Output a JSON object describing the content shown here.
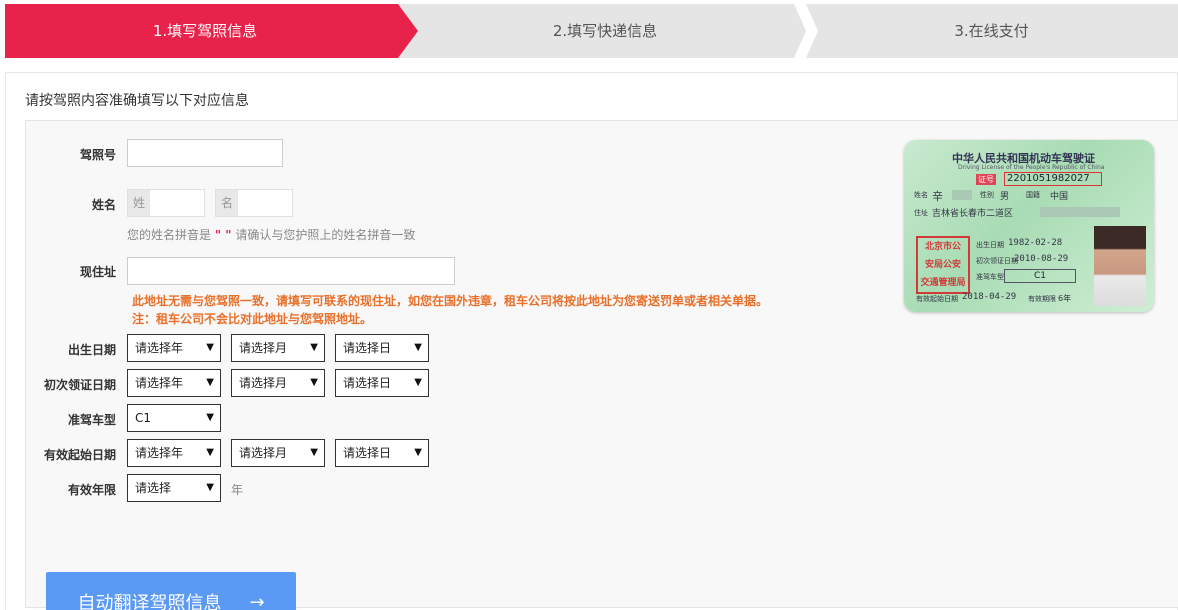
{
  "steps": [
    {
      "label": "1.填写驾照信息",
      "active": true
    },
    {
      "label": "2.填写快递信息",
      "active": false
    },
    {
      "label": "3.在线支付",
      "active": false
    }
  ],
  "colors": {
    "accent": "#e8234b",
    "inactive_step": "#e5e5e5",
    "button": "#5b9af4",
    "warning": "#e8702a"
  },
  "intro": "请按驾照内容准确填写以下对应信息",
  "form": {
    "license_no_label": "驾照号",
    "license_no_value": "",
    "name_label": "姓名",
    "surname_prefix": "姓",
    "given_prefix": "名",
    "name_hint_before": "您的姓名拼音是",
    "name_hint_quote": "\" \"",
    "name_hint_after": "请确认与您护照上的姓名拼音一致",
    "address_label": "现住址",
    "address_value": "",
    "address_warning_1": "此地址无需与您驾照一致，请填写可联系的现住址，如您在国外违章，租车公司将按此地址为您寄送罚单或者相关单据。",
    "address_warning_2": "注：租车公司不会比对此地址与您驾照地址。",
    "birth_label": "出生日期",
    "first_issue_label": "初次领证日期",
    "vehicle_class_label": "准驾车型",
    "valid_start_label": "有效起始日期",
    "valid_years_label": "有效年限",
    "year_placeholder": "请选择年",
    "month_placeholder": "请选择月",
    "day_placeholder": "请选择日",
    "vehicle_class_value": "C1",
    "valid_years_placeholder": "请选择",
    "valid_years_unit": "年"
  },
  "button": {
    "label": "自动翻译驾照信息",
    "icon": "arrow-right-icon"
  },
  "license_card": {
    "title": "中华人民共和国机动车驾驶证",
    "subtitle": "Driving License of the People's Republic of China",
    "id_tag": "证号",
    "id_number": "2201051982027",
    "name_key": "姓名",
    "name_value": "辛",
    "sex_key": "性别",
    "sex_value": "男",
    "nationality_key": "国籍",
    "nationality_value": "中国",
    "address_key": "住址",
    "address_value": "吉林省长春市二道区",
    "seal_lines": [
      "北京市公",
      "安局公安",
      "交通管理局"
    ],
    "birth_key": "出生日期",
    "birth_value": "1982-02-28",
    "first_issue_key": "初次领证日期",
    "first_issue_value": "2010-08-29",
    "class_key": "准驾车型",
    "class_value": "C1",
    "valid_key": "有效起始日期",
    "valid_value": "2018-04-29",
    "valid_period_key": "有效期限",
    "valid_period_value": "6年"
  }
}
